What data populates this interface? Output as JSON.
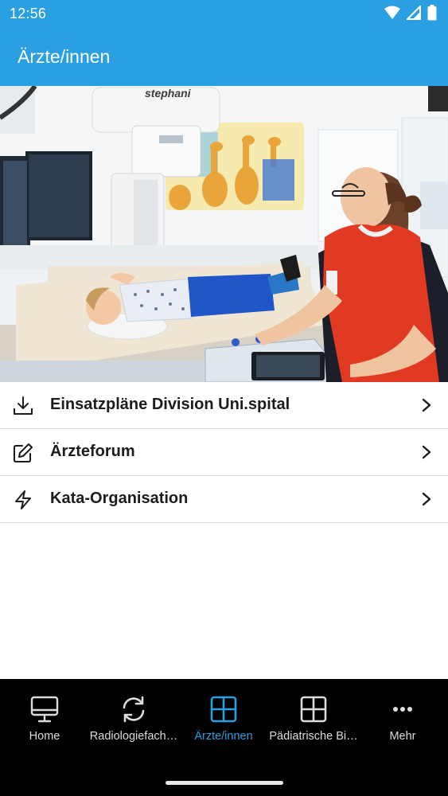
{
  "status": {
    "time": "12:56"
  },
  "app": {
    "title": "Ärzte/innen"
  },
  "hero": {
    "machine_brand": "stephani"
  },
  "menu": [
    {
      "label": "Einsatzpläne Division Uni.spital",
      "icon": "download-icon"
    },
    {
      "label": "Ärzteforum",
      "icon": "edit-icon"
    },
    {
      "label": "Kata-Organisation",
      "icon": "lightning-icon"
    }
  ],
  "nav": [
    {
      "label": "Home",
      "icon": "monitor-icon"
    },
    {
      "label": "Radiologiefach…",
      "icon": "refresh-icon"
    },
    {
      "label": "Ärzte/innen",
      "icon": "grid-icon",
      "active": true
    },
    {
      "label": "Pädiatrische Bi…",
      "icon": "grid-icon"
    },
    {
      "label": "Mehr",
      "icon": "more-icon"
    }
  ],
  "colors": {
    "primary": "#2a9fe1",
    "nav_bg": "#000000",
    "vest": "#e23a22"
  }
}
